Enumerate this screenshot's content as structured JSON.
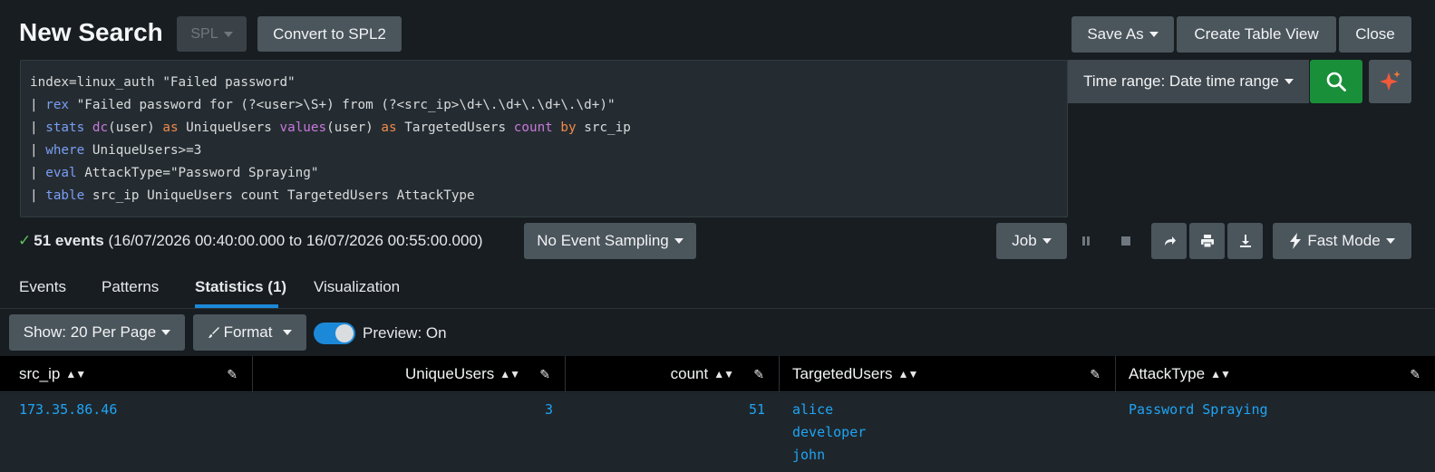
{
  "header": {
    "title": "New Search",
    "spl_label": "SPL",
    "convert_label": "Convert to SPL2",
    "save_as_label": "Save As",
    "create_table_label": "Create Table View",
    "close_label": "Close"
  },
  "search": {
    "lines": [
      {
        "parts": [
          {
            "t": "index=linux_auth \"Failed password\"",
            "c": "plain"
          }
        ]
      },
      {
        "parts": [
          {
            "t": "| ",
            "c": "plain"
          },
          {
            "t": "rex",
            "c": "cmd"
          },
          {
            "t": " \"Failed password for (?<user>\\S+) from (?<src_ip>\\d+\\.\\d+\\.\\d+\\.\\d+)\"",
            "c": "plain"
          }
        ]
      },
      {
        "parts": [
          {
            "t": "| ",
            "c": "plain"
          },
          {
            "t": "stats",
            "c": "cmd"
          },
          {
            "t": " ",
            "c": "plain"
          },
          {
            "t": "dc",
            "c": "fn"
          },
          {
            "t": "(user) ",
            "c": "plain"
          },
          {
            "t": "as",
            "c": "as"
          },
          {
            "t": " UniqueUsers ",
            "c": "plain"
          },
          {
            "t": "values",
            "c": "fn"
          },
          {
            "t": "(user) ",
            "c": "plain"
          },
          {
            "t": "as",
            "c": "as"
          },
          {
            "t": " TargetedUsers ",
            "c": "plain"
          },
          {
            "t": "count",
            "c": "fn"
          },
          {
            "t": " ",
            "c": "plain"
          },
          {
            "t": "by",
            "c": "as"
          },
          {
            "t": " src_ip",
            "c": "plain"
          }
        ]
      },
      {
        "parts": [
          {
            "t": "| ",
            "c": "plain"
          },
          {
            "t": "where",
            "c": "cmd"
          },
          {
            "t": " UniqueUsers>=3",
            "c": "plain"
          }
        ]
      },
      {
        "parts": [
          {
            "t": "| ",
            "c": "plain"
          },
          {
            "t": "eval",
            "c": "cmd"
          },
          {
            "t": " AttackType=\"Password Spraying\"",
            "c": "plain"
          }
        ]
      },
      {
        "parts": [
          {
            "t": "| ",
            "c": "plain"
          },
          {
            "t": "table",
            "c": "cmd"
          },
          {
            "t": " src_ip UniqueUsers count TargetedUsers AttackType",
            "c": "plain"
          }
        ]
      }
    ],
    "time_range_label": "Time range: Date time range"
  },
  "status": {
    "check": "✓",
    "events_count": "51 events",
    "range_text": "(16/07/2026 00:40:00.000 to 16/07/2026 00:55:00.000)",
    "sampling_label": "No Event Sampling",
    "job_label": "Job",
    "mode_label": "Fast Mode"
  },
  "tabs": [
    {
      "label": "Events"
    },
    {
      "label": "Patterns"
    },
    {
      "label": "Statistics (1)"
    },
    {
      "label": "Visualization"
    }
  ],
  "toolbar": {
    "show_label": "Show: 20 Per Page",
    "format_label": "Format",
    "preview_label": "Preview: On"
  },
  "table": {
    "columns": [
      "src_ip",
      "UniqueUsers",
      "count",
      "TargetedUsers",
      "AttackType"
    ],
    "row": {
      "src_ip": "173.35.86.46",
      "unique_users": "3",
      "count": "51",
      "targeted_users": [
        "alice",
        "developer",
        "john"
      ],
      "attack_type": "Password Spraying"
    }
  },
  "colors": {
    "accent": "#1c89d8",
    "search_button": "#1a8f3a",
    "link": "#1fa4f5"
  }
}
